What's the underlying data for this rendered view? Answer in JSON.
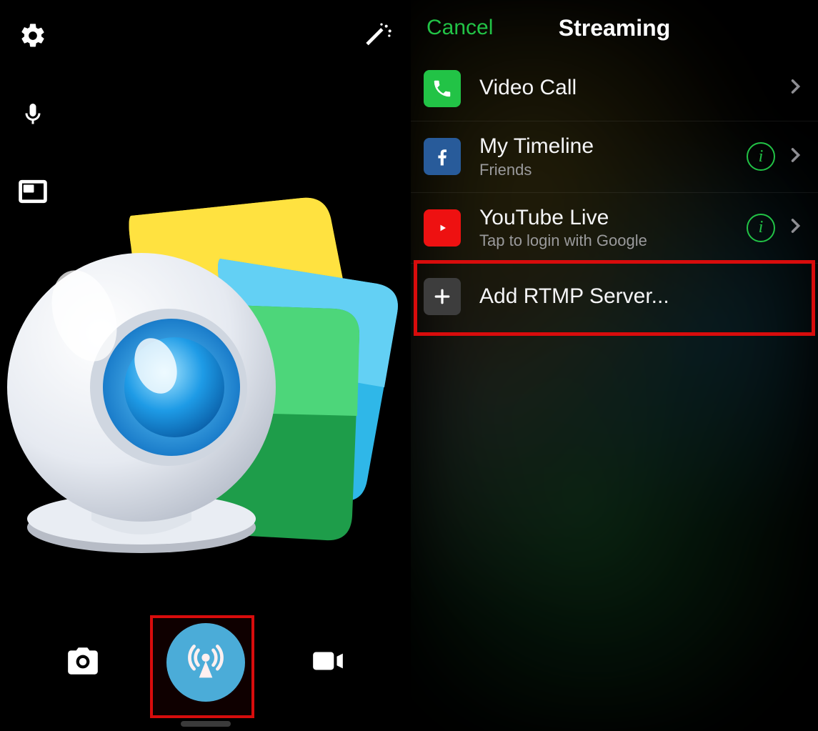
{
  "left": {
    "icons": {
      "settings": "settings",
      "wand": "magic-wand",
      "mic": "microphone",
      "pip": "picture-in-picture"
    },
    "modes": {
      "photo": "photo",
      "stream": "broadcast",
      "video": "video"
    },
    "highlight": "stream"
  },
  "right": {
    "nav": {
      "cancel": "Cancel",
      "title": "Streaming"
    },
    "rows": [
      {
        "id": "video-call",
        "label": "Video Call",
        "sub": "",
        "icon": "phone",
        "info": false
      },
      {
        "id": "my-timeline",
        "label": "My Timeline",
        "sub": "Friends",
        "icon": "facebook",
        "info": true
      },
      {
        "id": "youtube-live",
        "label": "YouTube Live",
        "sub": "Tap to login with Google",
        "icon": "youtube",
        "info": true
      },
      {
        "id": "add-rtmp",
        "label": "Add RTMP Server...",
        "sub": "",
        "icon": "plus",
        "info": false,
        "no_chevron": true
      }
    ],
    "highlight": "add-rtmp"
  },
  "colors": {
    "accent_green": "#22c346",
    "accent_blue": "#40b7e6",
    "highlight_red": "#d80c0c"
  }
}
